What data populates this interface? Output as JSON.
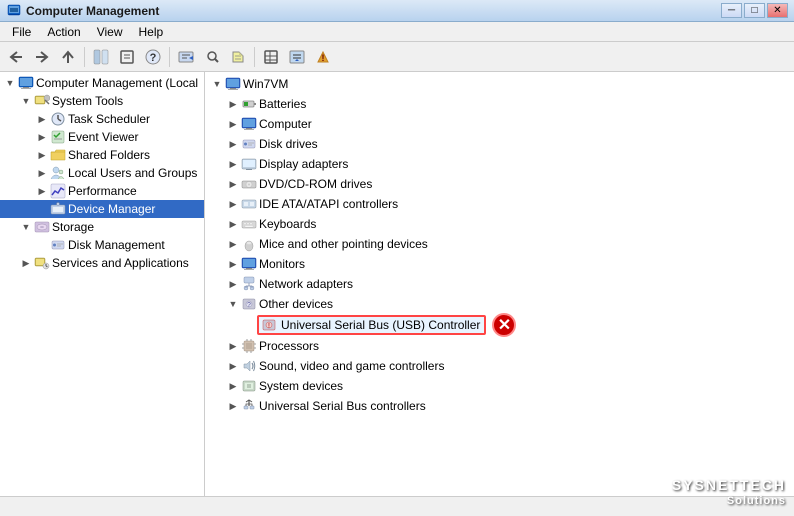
{
  "window": {
    "title": "Computer Management",
    "icon": "computer-management-icon"
  },
  "menu": {
    "items": [
      "File",
      "Action",
      "View",
      "Help"
    ]
  },
  "toolbar": {
    "buttons": [
      "back",
      "forward",
      "up",
      "show-hide-tree",
      "properties",
      "help",
      "separator1",
      "new-window",
      "separator2",
      "export-list",
      "separator3",
      "show-log",
      "separator4",
      "more1",
      "more2",
      "more3"
    ]
  },
  "left_tree": {
    "items": [
      {
        "id": "computer-management",
        "label": "Computer Management (Local",
        "level": 0,
        "expanded": true,
        "icon": "computer-mgmt-icon"
      },
      {
        "id": "system-tools",
        "label": "System Tools",
        "level": 1,
        "expanded": true,
        "icon": "system-tools-icon"
      },
      {
        "id": "task-scheduler",
        "label": "Task Scheduler",
        "level": 2,
        "expanded": false,
        "icon": "task-scheduler-icon"
      },
      {
        "id": "event-viewer",
        "label": "Event Viewer",
        "level": 2,
        "expanded": false,
        "icon": "event-viewer-icon"
      },
      {
        "id": "shared-folders",
        "label": "Shared Folders",
        "level": 2,
        "expanded": false,
        "icon": "shared-folders-icon"
      },
      {
        "id": "local-users",
        "label": "Local Users and Groups",
        "level": 2,
        "expanded": false,
        "icon": "users-icon"
      },
      {
        "id": "performance",
        "label": "Performance",
        "level": 2,
        "expanded": false,
        "icon": "performance-icon"
      },
      {
        "id": "device-manager",
        "label": "Device Manager",
        "level": 2,
        "expanded": false,
        "icon": "device-manager-icon",
        "selected": true
      },
      {
        "id": "storage",
        "label": "Storage",
        "level": 1,
        "expanded": true,
        "icon": "storage-icon"
      },
      {
        "id": "disk-management",
        "label": "Disk Management",
        "level": 2,
        "expanded": false,
        "icon": "disk-mgmt-icon"
      },
      {
        "id": "services-applications",
        "label": "Services and Applications",
        "level": 1,
        "expanded": false,
        "icon": "services-icon"
      }
    ]
  },
  "right_tree": {
    "root_label": "Win7VM",
    "items": [
      {
        "id": "batteries",
        "label": "Batteries",
        "level": 1,
        "expanded": false,
        "icon": "batteries-icon"
      },
      {
        "id": "computer",
        "label": "Computer",
        "level": 1,
        "expanded": false,
        "icon": "computer-icon"
      },
      {
        "id": "disk-drives",
        "label": "Disk drives",
        "level": 1,
        "expanded": false,
        "icon": "disk-drives-icon"
      },
      {
        "id": "display-adapters",
        "label": "Display adapters",
        "level": 1,
        "expanded": false,
        "icon": "display-adapters-icon"
      },
      {
        "id": "dvd-cdrom",
        "label": "DVD/CD-ROM drives",
        "level": 1,
        "expanded": false,
        "icon": "dvd-icon"
      },
      {
        "id": "ide-ata",
        "label": "IDE ATA/ATAPI controllers",
        "level": 1,
        "expanded": false,
        "icon": "ide-icon"
      },
      {
        "id": "keyboards",
        "label": "Keyboards",
        "level": 1,
        "expanded": false,
        "icon": "keyboards-icon"
      },
      {
        "id": "mice",
        "label": "Mice and other pointing devices",
        "level": 1,
        "expanded": false,
        "icon": "mice-icon"
      },
      {
        "id": "monitors",
        "label": "Monitors",
        "level": 1,
        "expanded": false,
        "icon": "monitors-icon"
      },
      {
        "id": "network-adapters",
        "label": "Network adapters",
        "level": 1,
        "expanded": false,
        "icon": "network-icon"
      },
      {
        "id": "other-devices",
        "label": "Other devices",
        "level": 1,
        "expanded": true,
        "icon": "other-devices-icon"
      },
      {
        "id": "usb-controller",
        "label": "Universal Serial Bus (USB) Controller",
        "level": 2,
        "expanded": false,
        "icon": "usb-icon",
        "highlighted": true,
        "error": true
      },
      {
        "id": "processors",
        "label": "Processors",
        "level": 1,
        "expanded": false,
        "icon": "processors-icon"
      },
      {
        "id": "sound-video",
        "label": "Sound, video and game controllers",
        "level": 1,
        "expanded": false,
        "icon": "sound-icon"
      },
      {
        "id": "system-devices",
        "label": "System devices",
        "level": 1,
        "expanded": false,
        "icon": "system-devices-icon"
      },
      {
        "id": "usb-controllers",
        "label": "Universal Serial Bus controllers",
        "level": 1,
        "expanded": false,
        "icon": "usb-controllers-icon"
      }
    ]
  },
  "watermark": {
    "main": "SYSNETTECH",
    "sub": "Solutions"
  },
  "status": ""
}
